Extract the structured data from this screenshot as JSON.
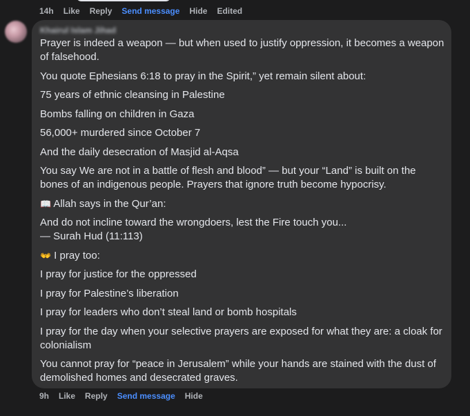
{
  "top_actions": {
    "time": "14h",
    "like": "Like",
    "reply": "Reply",
    "send_message": "Send message",
    "hide": "Hide",
    "edited": "Edited"
  },
  "comment": {
    "author": "Khairul Islam Jihad",
    "paragraphs": [
      "Prayer is indeed a weapon — but when used to justify oppression, it becomes a weapon of falsehood.",
      "You quote Ephesians 6:18 to pray in the Spirit,” yet remain silent about:",
      "75 years of ethnic cleansing in Palestine",
      "Bombs falling on children in Gaza",
      "56,000+ murdered since October 7",
      "And the daily desecration of Masjid al-Aqsa",
      "You say We are not in a battle of flesh and blood” — but your “Land” is built on the bones of an indigenous people. Prayers that ignore truth become hypocrisy.",
      "Allah says in the Qur’an:",
      "And do not incline toward the wrongdoers, lest the Fire touch you...",
      "— Surah Hud (11:113)",
      "I pray too:",
      "I pray for justice for the oppressed",
      "I pray for Palestine’s liberation",
      "I pray for leaders who don’t steal land or bomb hospitals",
      "I pray for the day when your selective prayers are exposed for what they are: a cloak for colonialism",
      "You cannot pray for “peace in Jerusalem” while your hands are stained with the dust of demolished homes and desecrated graves."
    ],
    "icons": {
      "book": "📖",
      "hands": "👐"
    }
  },
  "bottom_actions": {
    "time": "9h",
    "like": "Like",
    "reply": "Reply",
    "send_message": "Send message",
    "hide": "Hide"
  },
  "colors": {
    "background": "#1c1c1d",
    "bubble": "#333334",
    "text": "#e4e6eb",
    "muted": "#b0b3b8",
    "link": "#4b8eff"
  }
}
